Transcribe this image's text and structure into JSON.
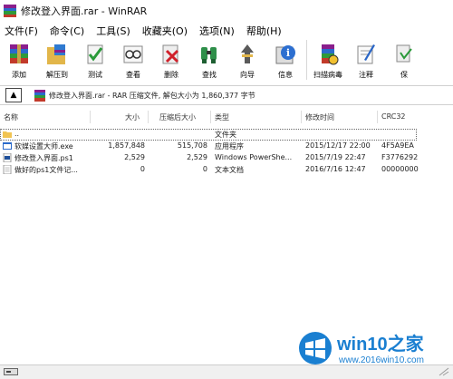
{
  "window": {
    "title": "修改登入界面.rar - WinRAR"
  },
  "menu": [
    {
      "label": "文件(F)"
    },
    {
      "label": "命令(C)"
    },
    {
      "label": "工具(S)"
    },
    {
      "label": "收藏夹(O)"
    },
    {
      "label": "选项(N)"
    },
    {
      "label": "帮助(H)"
    }
  ],
  "toolbar": [
    {
      "label": "添加",
      "icon": "add-icon"
    },
    {
      "label": "解压到",
      "icon": "extract-icon"
    },
    {
      "label": "测试",
      "icon": "test-icon"
    },
    {
      "label": "查看",
      "icon": "view-icon"
    },
    {
      "label": "删除",
      "icon": "delete-icon"
    },
    {
      "label": "查找",
      "icon": "find-icon"
    },
    {
      "label": "向导",
      "icon": "wizard-icon"
    },
    {
      "label": "信息",
      "icon": "info-icon"
    },
    {
      "label": "扫描病毒",
      "icon": "virus-scan-icon"
    },
    {
      "label": "注释",
      "icon": "comment-icon"
    },
    {
      "label": "保",
      "icon": "protect-icon"
    }
  ],
  "path": {
    "text": "修改登入界面.rar - RAR 压缩文件, 解包大小为 1,860,377 字节"
  },
  "columns": [
    "名称",
    "大小",
    "压缩后大小",
    "类型",
    "修改时间",
    "CRC32"
  ],
  "files": [
    {
      "name": "..",
      "size": "",
      "packed": "",
      "type": "文件夹",
      "modified": "",
      "crc": ""
    },
    {
      "name": "软媒设置大师.exe",
      "size": "1,857,848",
      "packed": "515,708",
      "type": "应用程序",
      "modified": "2015/12/17 22:00",
      "crc": "4F5A9EA"
    },
    {
      "name": "修改登入界面.ps1",
      "size": "2,529",
      "packed": "2,529",
      "type": "Windows PowerShe...",
      "modified": "2015/7/19 22:47",
      "crc": "F3776292"
    },
    {
      "name": "做好的ps1文件记...",
      "size": "0",
      "packed": "0",
      "type": "文本文档",
      "modified": "2016/7/16 12:47",
      "crc": "00000000"
    }
  ],
  "watermark": {
    "brand": "win10之家",
    "url": "www.2016win10.com"
  },
  "colors": {
    "selection_outline": "#666666",
    "watermark_blue": "#1a7fd1"
  }
}
